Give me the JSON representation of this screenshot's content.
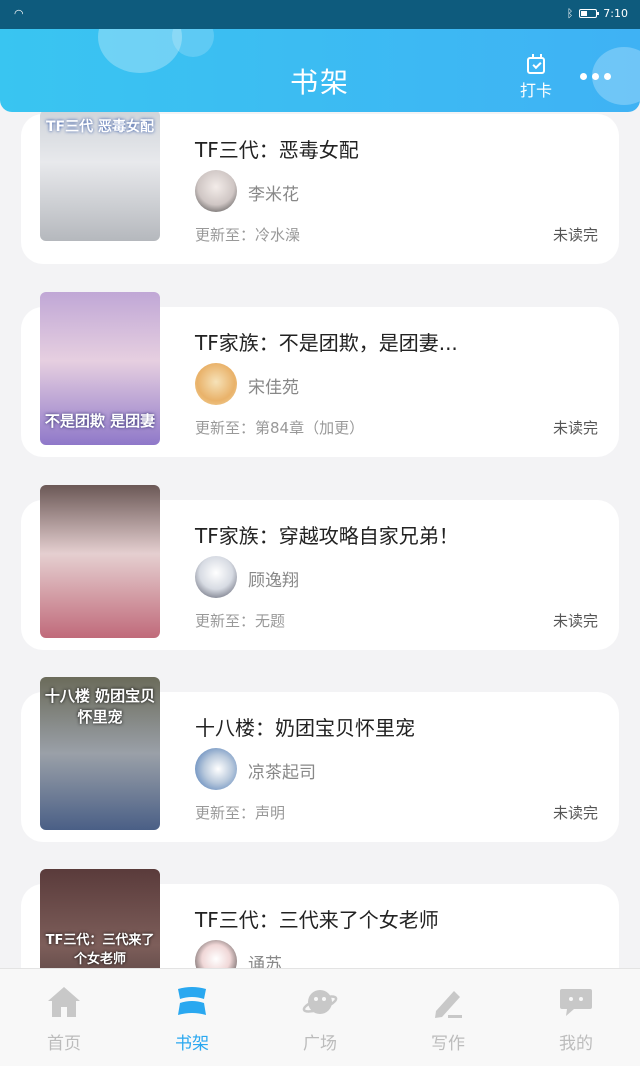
{
  "status_bar": {
    "time": "7:10"
  },
  "header": {
    "title": "书架",
    "checkin_label": "打卡"
  },
  "books": [
    {
      "title": "TF三代：恶毒女配",
      "cover_text": "TF三代 恶毒女配",
      "author": "李米花",
      "update": "更新至：冷水澡",
      "status": "未读完"
    },
    {
      "title": "TF家族：不是团欺，是团妻...",
      "cover_text": "不是团欺 是团妻",
      "author": "宋佳苑",
      "update": "更新至：第84章（加更）",
      "status": "未读完"
    },
    {
      "title": "TF家族：穿越攻略自家兄弟！",
      "cover_text": "",
      "author": "顾逸翔",
      "update": "更新至：无题",
      "status": "未读完"
    },
    {
      "title": "十八楼：奶团宝贝怀里宠",
      "cover_text": "十八楼 奶团宝贝怀里宠",
      "author": "凉茶起司",
      "update": "更新至：声明",
      "status": "未读完"
    },
    {
      "title": "TF三代：三代来了个女老师",
      "cover_text": "TF三代：三代来了个女老师",
      "author": "诵苏",
      "update": "",
      "status": ""
    }
  ],
  "nav": [
    {
      "label": "首页",
      "icon": "home-icon"
    },
    {
      "label": "书架",
      "icon": "bookshelf-icon"
    },
    {
      "label": "广场",
      "icon": "planet-icon"
    },
    {
      "label": "写作",
      "icon": "pen-icon"
    },
    {
      "label": "我的",
      "icon": "chat-bubble-icon"
    }
  ],
  "colors": {
    "accent": "#2aa8f0",
    "header_start": "#39c5f1",
    "header_end": "#3fb2f4",
    "inactive": "#bcbcbc"
  }
}
